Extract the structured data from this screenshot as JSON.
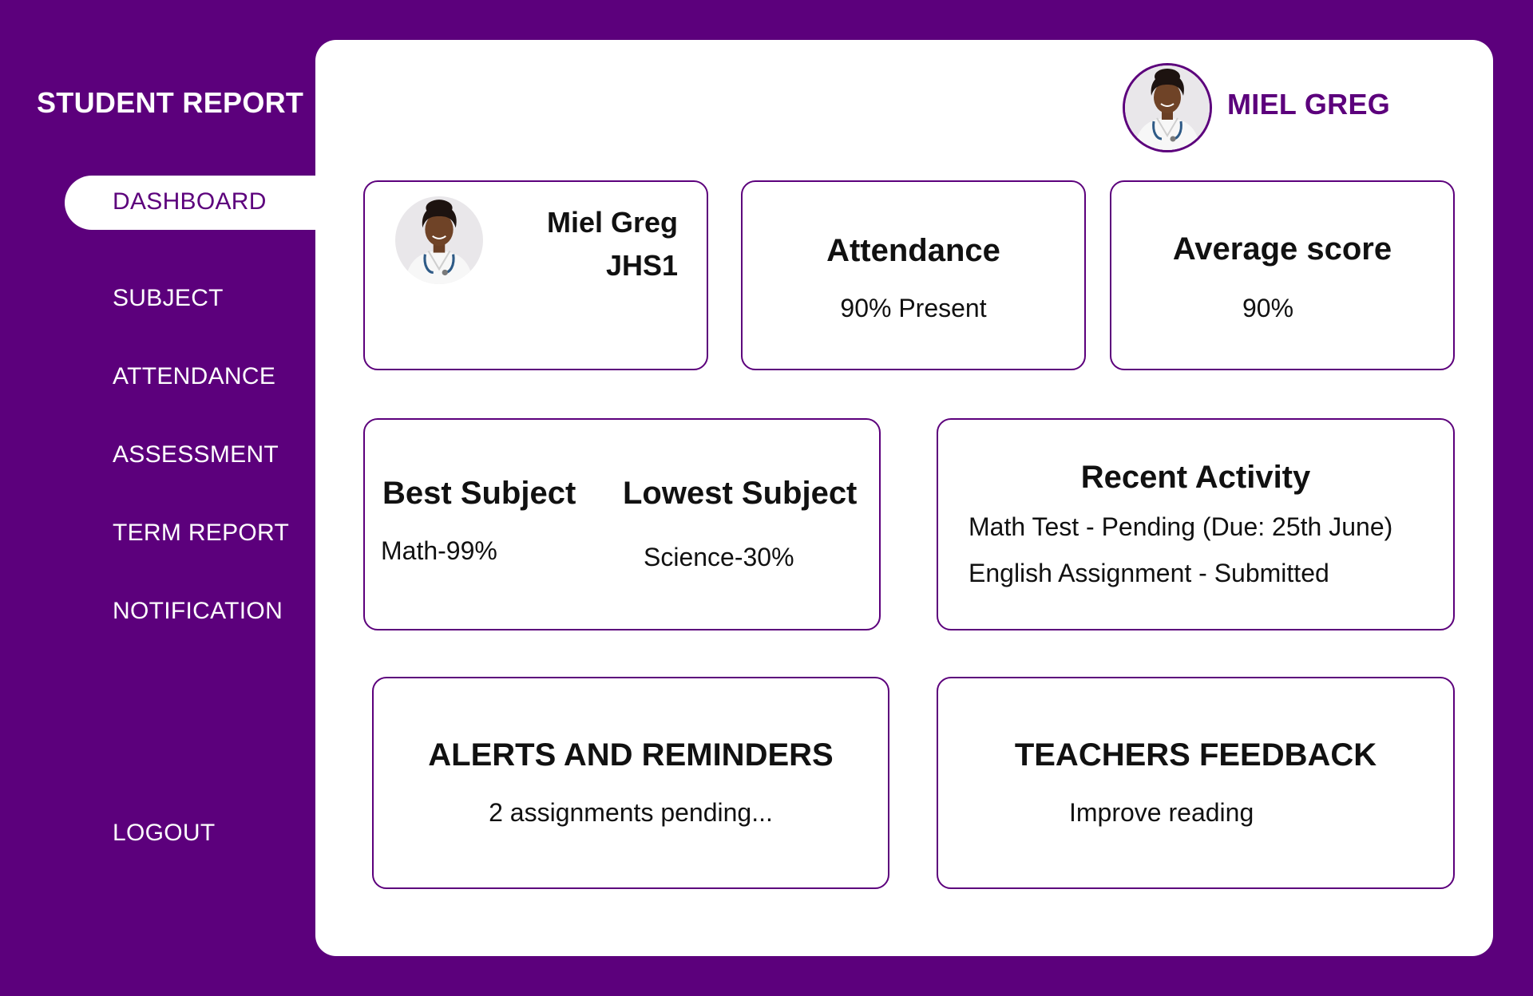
{
  "app": {
    "title": "STUDENT REPORT"
  },
  "sidebar": {
    "items": [
      {
        "label": "DASHBOARD"
      },
      {
        "label": "SUBJECT"
      },
      {
        "label": "ATTENDANCE"
      },
      {
        "label": "ASSESSMENT"
      },
      {
        "label": "TERM REPORT"
      },
      {
        "label": "NOTIFICATION"
      }
    ],
    "logout_label": "LOGOUT"
  },
  "header": {
    "user_name": "MIEL GREG"
  },
  "cards": {
    "student": {
      "name": "Miel Greg",
      "class": "JHS1"
    },
    "attendance": {
      "title": "Attendance",
      "value": "90% Present"
    },
    "average": {
      "title": "Average score",
      "value": "90%"
    },
    "subjects": {
      "best_title": "Best Subject",
      "best_value": "Math-99%",
      "lowest_title": "Lowest Subject",
      "lowest_value": "Science-30%"
    },
    "recent": {
      "title": "Recent Activity",
      "items": [
        "Math Test - Pending (Due: 25th June)",
        "English Assignment - Submitted"
      ]
    },
    "alerts": {
      "title": "ALERTS AND REMINDERS",
      "text": "2 assignments pending..."
    },
    "feedback": {
      "title": "TEACHERS FEEDBACK",
      "text": "Improve reading"
    }
  },
  "colors": {
    "brand": "#5c007c",
    "card_border": "#5c007c",
    "surface": "#ffffff"
  }
}
